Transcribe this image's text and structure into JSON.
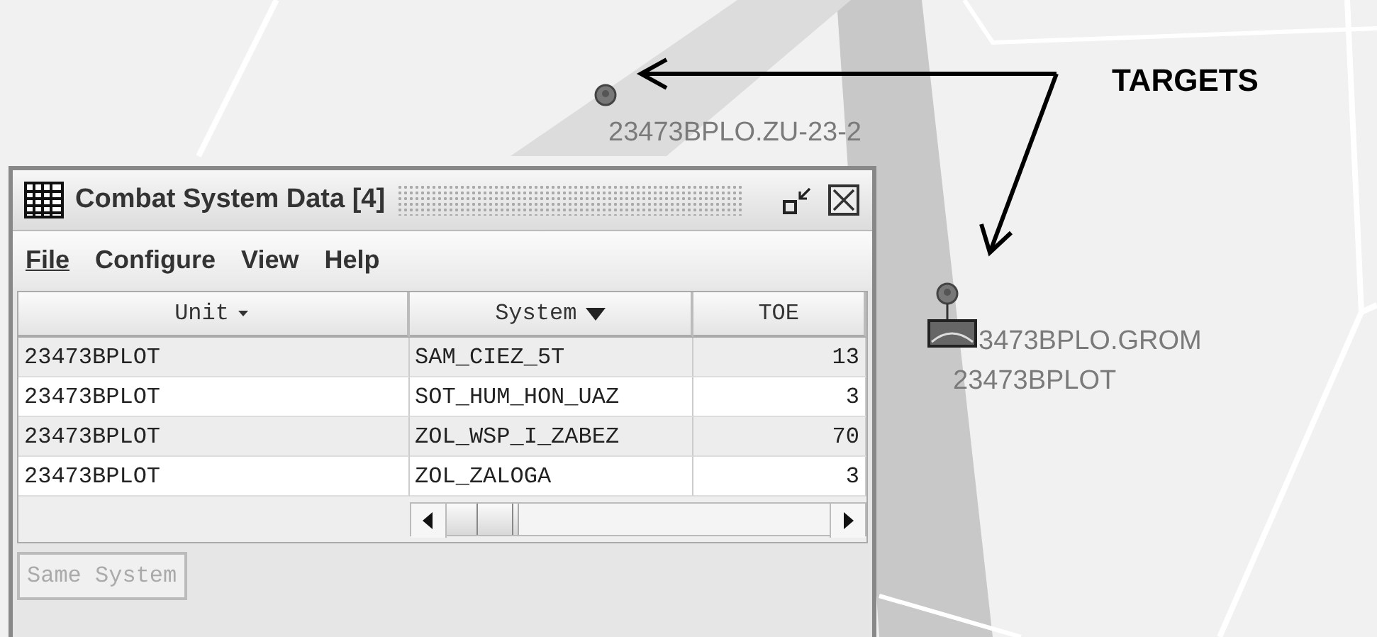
{
  "map": {
    "markers": [
      {
        "kind": "unit",
        "label": "23473BPLO.ZU-23-2"
      },
      {
        "kind": "unit-with-system",
        "label": "3473BPLO.GROM",
        "sublabel": "23473BPLOT"
      }
    ],
    "annotation": {
      "text": "TARGETS"
    }
  },
  "window": {
    "title": "Combat System Data [4]",
    "menu": [
      {
        "label": "File",
        "mnemonic": true
      },
      {
        "label": "Configure",
        "mnemonic": false
      },
      {
        "label": "View",
        "mnemonic": false
      },
      {
        "label": "Help",
        "mnemonic": false
      }
    ],
    "table": {
      "columns": [
        {
          "label": "Unit",
          "sorted": true,
          "primary": false
        },
        {
          "label": "System",
          "sorted": true,
          "primary": true
        },
        {
          "label": "TOE",
          "sorted": false
        }
      ],
      "rows": [
        [
          "23473BPLOT",
          "SAM_CIEZ_5T",
          "13"
        ],
        [
          "23473BPLOT",
          "SOT_HUM_HON_UAZ",
          "3"
        ],
        [
          "23473BPLOT",
          "ZOL_WSP_I_ZABEZ",
          "70"
        ],
        [
          "23473BPLOT",
          "ZOL_ZALOGA",
          "3"
        ]
      ]
    },
    "button": {
      "label": "Same System",
      "disabled": true
    }
  }
}
